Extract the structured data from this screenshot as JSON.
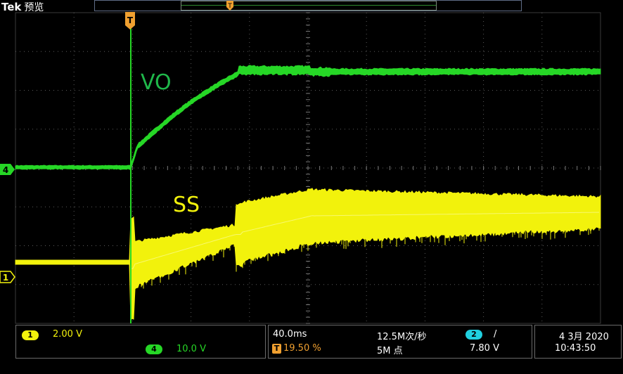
{
  "header": {
    "brand": "Tek",
    "mode": "预览"
  },
  "trigger_marker": "T",
  "channel_markers": {
    "ch4": "4",
    "ch1": "1"
  },
  "labels": {
    "vo": "VO",
    "ss": "SS"
  },
  "colors": {
    "ch1": "#f2f20c",
    "ch4": "#26d726",
    "trigger": "#f0a030",
    "ch2": "#20d0e0",
    "grid": "#5a5a5a"
  },
  "status": {
    "ch1_num": "1",
    "ch1_scale": "2.00 V",
    "ch4_num": "4",
    "ch4_scale": "10.0 V",
    "timebase": "40.0ms",
    "sample_rate": "12.5M次/秒",
    "trig_source_num": "2",
    "trig_slope": "/",
    "trig_letter": "T",
    "trig_pos": "19.50 %",
    "record_length": "5M 点",
    "trig_level": "7.80 V",
    "date": "4 3月 2020",
    "time": "10:43:50"
  }
}
